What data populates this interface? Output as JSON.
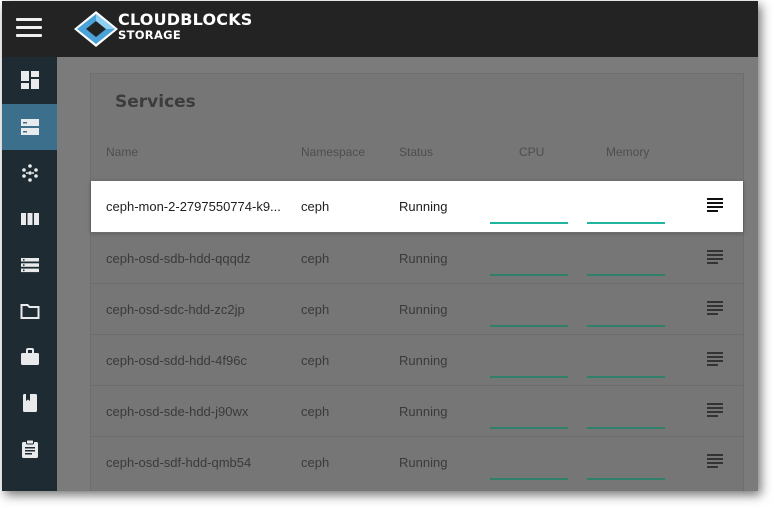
{
  "app": {
    "brand_line1": "CLOUDBLOCKS",
    "brand_line2": "STORAGE"
  },
  "sidebar": {
    "items": [
      {
        "icon": "dashboard-icon",
        "active": false
      },
      {
        "icon": "storage-server-icon",
        "active": true
      },
      {
        "icon": "cluster-nodes-icon",
        "active": false
      },
      {
        "icon": "columns-icon",
        "active": false
      },
      {
        "icon": "list-icon",
        "active": false
      },
      {
        "icon": "folder-icon",
        "active": false
      },
      {
        "icon": "briefcase-icon",
        "active": false
      },
      {
        "icon": "book-icon",
        "active": false
      },
      {
        "icon": "clipboard-icon",
        "active": false
      }
    ]
  },
  "services": {
    "title": "Services",
    "columns": {
      "name": "Name",
      "namespace": "Namespace",
      "status": "Status",
      "cpu": "CPU",
      "memory": "Memory"
    },
    "rows": [
      {
        "name": "ceph-mon-2-2797550774-k9...",
        "namespace": "ceph",
        "status": "Running",
        "selected": true
      },
      {
        "name": "ceph-osd-sdb-hdd-qqqdz",
        "namespace": "ceph",
        "status": "Running",
        "selected": false
      },
      {
        "name": "ceph-osd-sdc-hdd-zc2jp",
        "namespace": "ceph",
        "status": "Running",
        "selected": false
      },
      {
        "name": "ceph-osd-sdd-hdd-4f96c",
        "namespace": "ceph",
        "status": "Running",
        "selected": false
      },
      {
        "name": "ceph-osd-sde-hdd-j90wx",
        "namespace": "ceph",
        "status": "Running",
        "selected": false
      },
      {
        "name": "ceph-osd-sdf-hdd-qmb54",
        "namespace": "ceph",
        "status": "Running",
        "selected": false
      }
    ]
  },
  "colors": {
    "topbar": "#232323",
    "sidebar": "#1e2b33",
    "sidebar_active": "#3b6f8c",
    "overlay": "#7b7b7b",
    "sparkline": "#21b59f",
    "logo_blue": "#4aa3d8"
  }
}
